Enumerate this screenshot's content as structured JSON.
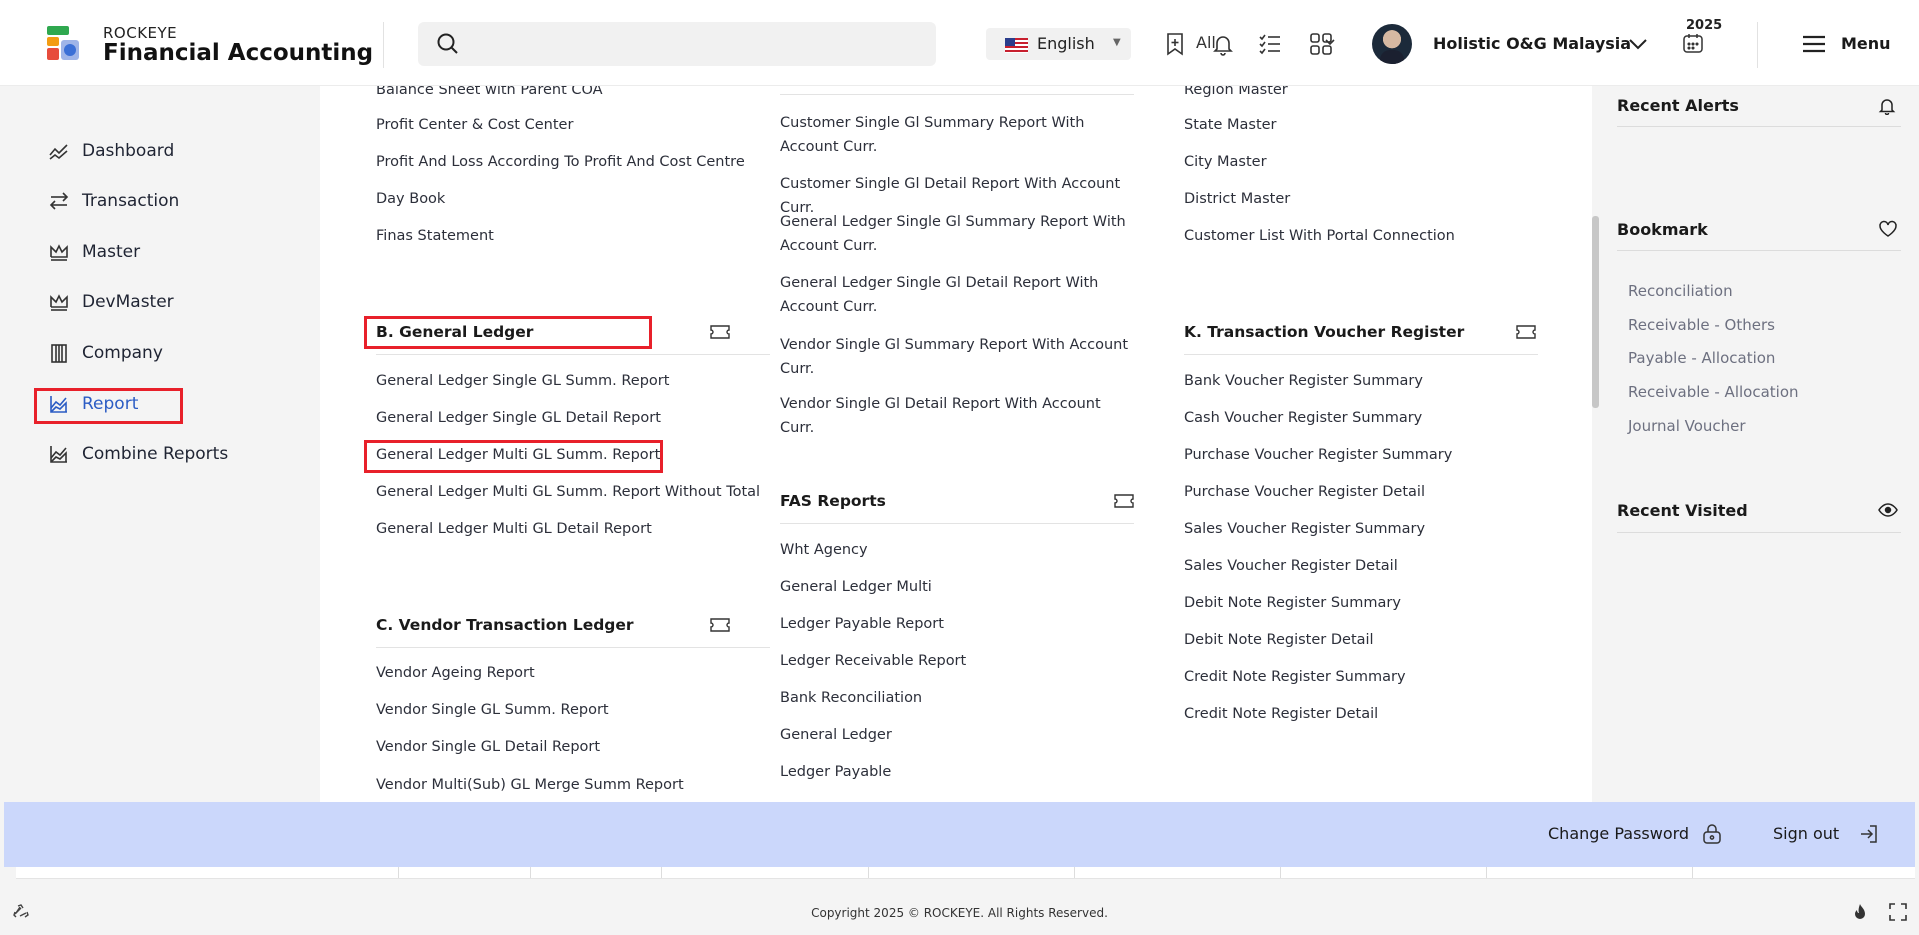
{
  "header": {
    "brand_small": "ROCKEYE",
    "brand_big": "Financial Accounting",
    "search_placeholder": "",
    "search_scope": "All",
    "language": "English",
    "company": "Holistic O&G Malaysia",
    "year": "2025",
    "menu_label": "Menu"
  },
  "sidebar": {
    "items": [
      {
        "label": "Dashboard",
        "icon": "trend-icon"
      },
      {
        "label": "Transaction",
        "icon": "arrows-icon"
      },
      {
        "label": "Master",
        "icon": "crown-icon"
      },
      {
        "label": "DevMaster",
        "icon": "crown-icon"
      },
      {
        "label": "Company",
        "icon": "building-icon"
      },
      {
        "label": "Report",
        "icon": "chart-icon",
        "active": true
      },
      {
        "label": "Combine Reports",
        "icon": "chart-icon"
      }
    ]
  },
  "col1": {
    "top_links": [
      "Balance Sheet with Parent COA",
      "Profit Center & Cost Center",
      "Profit And Loss According To Profit And Cost Centre",
      "Day Book",
      "Finas Statement"
    ],
    "section_b": {
      "title": "B. General Ledger",
      "links": [
        "General Ledger Single GL Summ. Report",
        "General Ledger Single GL Detail Report",
        "General Ledger Multi GL Summ. Report",
        "General Ledger Multi GL Summ. Report Without Total",
        "General Ledger Multi GL Detail Report"
      ]
    },
    "section_c": {
      "title": "C. Vendor Transaction Ledger",
      "links": [
        "Vendor Ageing Report",
        "Vendor Single GL Summ. Report",
        "Vendor Single GL Detail Report",
        "Vendor Multi(Sub) GL Merge Summ Report"
      ]
    }
  },
  "col2": {
    "top_links": [
      "Customer Single Gl Summary Report With Account Curr.",
      "Customer Single Gl Detail Report With Account Curr.",
      "General Ledger Single Gl Summary Report With Account Curr.",
      "General Ledger Single Gl Detail Report With Account Curr.",
      "Vendor Single Gl Summary Report With Account Curr.",
      "Vendor Single Gl Detail Report With Account Curr."
    ],
    "fas": {
      "title": "FAS Reports",
      "links": [
        "Wht Agency",
        "General Ledger Multi",
        "Ledger Payable Report",
        "Ledger Receivable Report",
        "Bank Reconciliation",
        "General Ledger",
        "Ledger Payable"
      ]
    }
  },
  "col3": {
    "top_links": [
      "Region Master",
      "State Master",
      "City Master",
      "District Master",
      "Customer List With Portal Connection"
    ],
    "section_k": {
      "title": "K. Transaction Voucher Register",
      "links": [
        "Bank Voucher Register Summary",
        "Cash Voucher Register Summary",
        "Purchase Voucher Register Summary",
        "Purchase Voucher Register Detail",
        "Sales Voucher Register Summary",
        "Sales Voucher Register Detail",
        "Debit Note Register Summary",
        "Debit Note Register Detail",
        "Credit Note Register Summary",
        "Credit Note Register Detail"
      ]
    }
  },
  "right_panel": {
    "recent_alerts": "Recent Alerts",
    "bookmark": "Bookmark",
    "bookmarks": [
      "Reconciliation",
      "Receivable - Others",
      "Payable - Allocation",
      "Receivable - Allocation",
      "Journal Voucher"
    ],
    "recent_visited": "Recent Visited"
  },
  "footer_bar": {
    "change_password": "Change Password",
    "sign_out": "Sign out"
  },
  "footer": {
    "copyright": "Copyright 2025 © ROCKEYE. All Rights Reserved."
  },
  "colors": {
    "accent": "#2b5cc4",
    "highlight_box": "#e8202a",
    "footer_bar": "#cbd7fb"
  }
}
